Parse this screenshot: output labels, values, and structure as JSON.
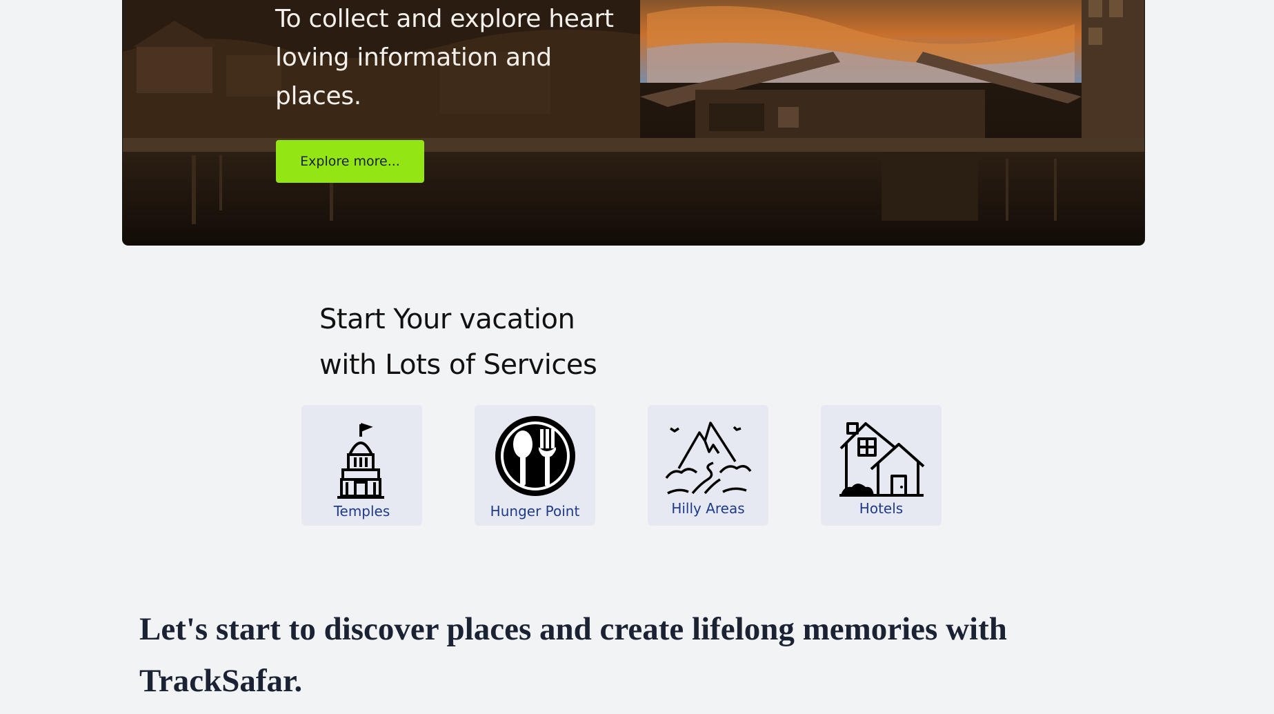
{
  "hero": {
    "headline": "To collect and explore heart loving information and places.",
    "cta_label": "Explore more..."
  },
  "services": {
    "heading_line1": "Start Your vacation",
    "heading_line2": "with Lots of Services",
    "items": [
      {
        "label": "Temples",
        "icon": "temple-icon"
      },
      {
        "label": "Hunger Point",
        "icon": "spoon-fork-icon"
      },
      {
        "label": "Hilly Areas",
        "icon": "mountain-icon"
      },
      {
        "label": "Hotels",
        "icon": "house-icon"
      }
    ]
  },
  "tagline": "Let's start to discover places and create lifelong memories with TrackSafar.",
  "colors": {
    "cta_background": "#93e613",
    "service_label": "#1f3a8a",
    "service_card": "#e6e9f1"
  }
}
